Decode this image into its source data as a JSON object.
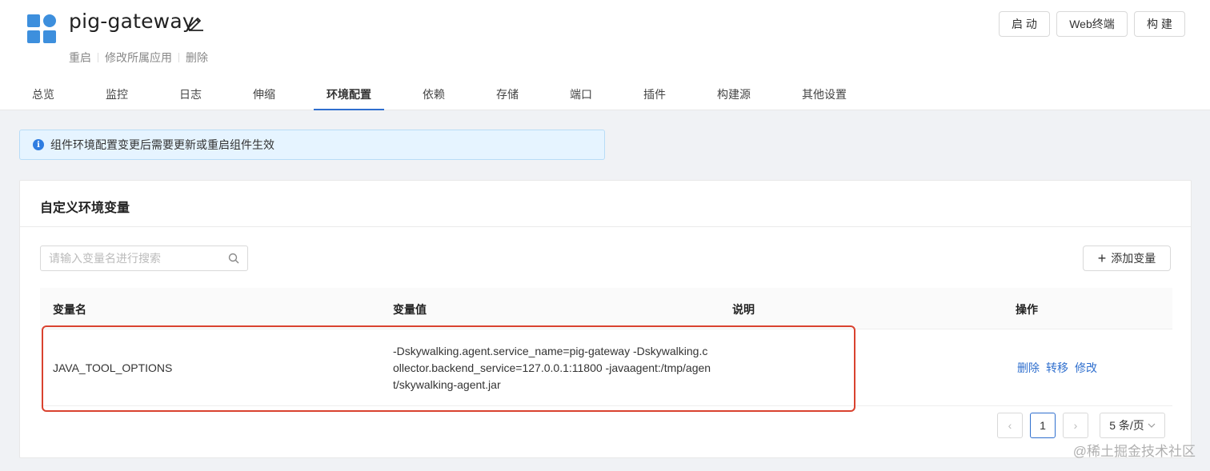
{
  "app": {
    "name": "pig-gateway",
    "sub_actions": [
      "重启",
      "修改所属应用",
      "删除"
    ]
  },
  "top_buttons": {
    "start": "启 动",
    "web_terminal": "Web终端",
    "build": "构 建"
  },
  "tabs": [
    "总览",
    "监控",
    "日志",
    "伸缩",
    "环境配置",
    "依赖",
    "存储",
    "端口",
    "插件",
    "构建源",
    "其他设置"
  ],
  "active_tab": "环境配置",
  "alert": {
    "text": "组件环境配置变更后需要更新或重启组件生效"
  },
  "env_card": {
    "title": "自定义环境变量",
    "search_placeholder": "请输入变量名进行搜索",
    "add_button": "添加变量",
    "columns": {
      "name": "变量名",
      "value": "变量值",
      "desc": "说明",
      "ops": "操作"
    },
    "rows": [
      {
        "name": "JAVA_TOOL_OPTIONS",
        "value": "-Dskywalking.agent.service_name=pig-gateway -Dskywalking.collector.backend_service=127.0.0.1:11800 -javaagent:/tmp/agent/skywalking-agent.jar",
        "desc": "",
        "ops": [
          "删除",
          "转移",
          "修改"
        ]
      }
    ]
  },
  "pagination": {
    "prev": "‹",
    "current": "1",
    "next": "›",
    "page_size": "5 条/页"
  },
  "watermark": "@稀土掘金技术社区",
  "colors": {
    "accent": "#2f6fce",
    "icon_blue": "#3d8fdd",
    "highlight_red": "#d9422f",
    "alert_bg": "#e6f4ff"
  }
}
